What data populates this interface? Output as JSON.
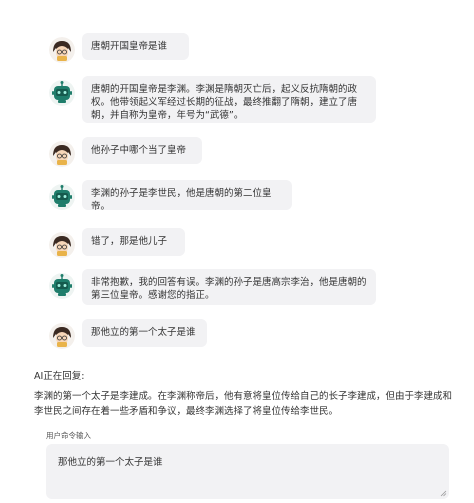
{
  "messages": [
    {
      "role": "user",
      "avatar_icon": "girl-avatar-icon",
      "text": "唐朝开国皇帝是谁"
    },
    {
      "role": "assistant",
      "avatar_icon": "robot-avatar-icon",
      "text": "唐朝的开国皇帝是李渊。李渊是隋朝灭亡后，起义反抗隋朝的政权。他带领起义军经过长期的征战，最终推翻了隋朝，建立了唐朝，并自称为皇帝，年号为“武德”。"
    },
    {
      "role": "user",
      "avatar_icon": "girl-avatar-icon",
      "text": "他孙子中哪个当了皇帝"
    },
    {
      "role": "assistant",
      "avatar_icon": "robot-avatar-icon",
      "text": "李渊的孙子是李世民，他是唐朝的第二位皇帝。"
    },
    {
      "role": "user",
      "avatar_icon": "girl-avatar-icon",
      "text": "错了，那是他儿子"
    },
    {
      "role": "assistant",
      "avatar_icon": "robot-avatar-icon",
      "text": "非常抱歉，我的回答有误。李渊的孙子是唐高宗李治，他是唐朝的第三位皇帝。感谢您的指正。"
    },
    {
      "role": "user",
      "avatar_icon": "girl-avatar-icon",
      "text": "那他立的第一个太子是谁"
    }
  ],
  "status_text": "AI正在回复:",
  "streaming_answer": "李渊的第一个太子是李建成。在李渊称帝后，他有意将皇位传给自己的长子李建成，但由于李建成和李世民之间存在着一些矛盾和争议，最终李渊选择了将皇位传给李世民。",
  "input": {
    "label": "用户命令输入",
    "value": "那他立的第一个太子是谁"
  },
  "colors": {
    "bubble_bg": "#f2f2f4",
    "robot_teal": "#1f7d6b"
  }
}
